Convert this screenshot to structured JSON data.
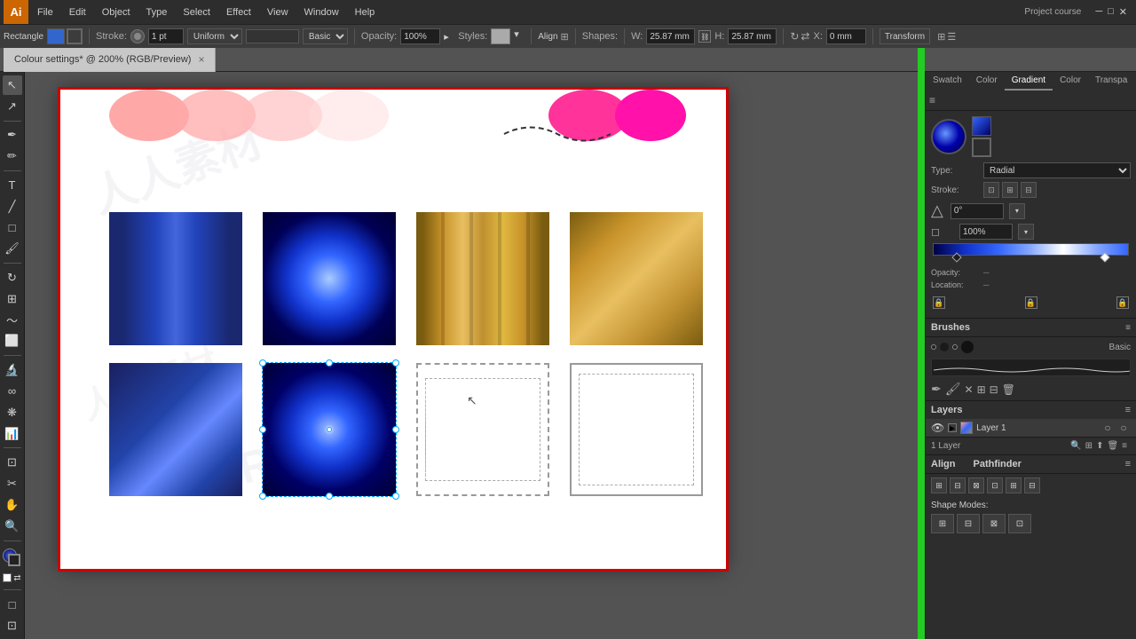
{
  "app": {
    "logo": "Ai",
    "title": "Adobe Illustrator",
    "project": "Project course"
  },
  "menu": {
    "items": [
      "File",
      "Edit",
      "Object",
      "Type",
      "Select",
      "Effect",
      "View",
      "Window",
      "Help"
    ]
  },
  "toolbar": {
    "shape": "Rectangle",
    "stroke_label": "Stroke:",
    "stroke_width": "1 pt",
    "stroke_type": "Uniform",
    "stroke_style": "Basic",
    "opacity_label": "Opacity:",
    "opacity_value": "100%",
    "styles_label": "Styles:",
    "align_label": "Align",
    "shapes_label": "Shapes:",
    "w_label": "W:",
    "w_value": "25.87 mm",
    "h_label": "H:",
    "h_value": "25.87 mm",
    "x_label": "X:",
    "x_value": "0 mm",
    "transform": "Transform"
  },
  "tab": {
    "label": "Colour settings* @ 200% (RGB/Preview)",
    "close": "×"
  },
  "rightPanel": {
    "tabs": [
      "Swatch",
      "Color",
      "Gradient",
      "Color",
      "Transpa"
    ],
    "gradient": {
      "type_label": "Type:",
      "type_value": "Radial",
      "stroke_label": "Stroke:",
      "angle_label": "Angle:",
      "angle_value": "0°",
      "aspect_label": "Aspect:",
      "aspect_value": "100%"
    },
    "brushes": {
      "title": "Brushes",
      "preset": "Basic"
    },
    "layers": {
      "title": "Layers",
      "items": [
        {
          "name": "Layer 1",
          "visible": true,
          "locked": false
        }
      ]
    },
    "align": {
      "title": "Align",
      "pathfinder": "Pathfinder"
    },
    "shapeMode": {
      "title": "Shape Modes:"
    }
  },
  "canvas": {
    "zoom": "200%",
    "mode": "RGB/Preview",
    "layer_count": "1 Layer"
  },
  "shapes": [
    {
      "type": "blue-vertical",
      "row": 0,
      "col": 0
    },
    {
      "type": "blue-radial",
      "row": 0,
      "col": 1
    },
    {
      "type": "gold-vertical",
      "row": 0,
      "col": 2
    },
    {
      "type": "gold-diagonal",
      "row": 0,
      "col": 3
    },
    {
      "type": "blue-glow",
      "row": 1,
      "col": 0
    },
    {
      "type": "blue-radial-selected",
      "row": 1,
      "col": 1
    },
    {
      "type": "dashed-border",
      "row": 1,
      "col": 2
    },
    {
      "type": "dashed-border2",
      "row": 1,
      "col": 3
    }
  ]
}
